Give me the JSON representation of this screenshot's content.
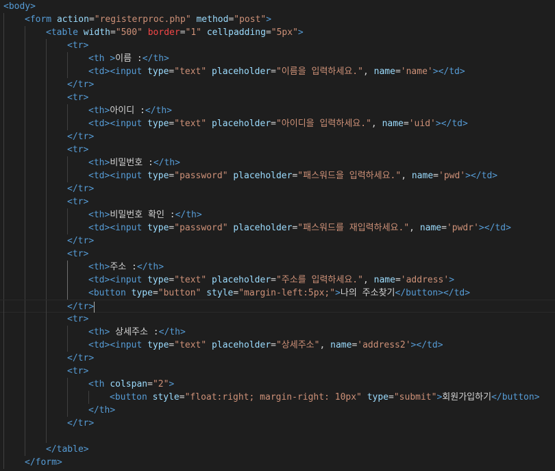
{
  "editor": {
    "language": "html",
    "colors": {
      "background": "#1e1e1e",
      "tag": "#569cd6",
      "attribute": "#9cdcfe",
      "string": "#ce9178",
      "text": "#d4d4d4",
      "deprecated_attribute": "#f44747"
    },
    "lines": [
      {
        "indent": 0,
        "code": "<body>"
      },
      {
        "indent": 1,
        "code": "<form action=\"registerproc.php\" method=\"post\">"
      },
      {
        "indent": 2,
        "code": "<table width=\"500\" border=\"1\" cellpadding=\"5px\">"
      },
      {
        "indent": 3,
        "code": "<tr>"
      },
      {
        "indent": 4,
        "code": "<th >이름 :</th>"
      },
      {
        "indent": 4,
        "code": "<td><input type=\"text\" placeholder=\"이름을 입력하세요.\", name='name'></td>"
      },
      {
        "indent": 3,
        "code": "</tr>"
      },
      {
        "indent": 3,
        "code": "<tr>"
      },
      {
        "indent": 4,
        "code": "<th>아이디 :</th>"
      },
      {
        "indent": 4,
        "code": "<td><input type=\"text\" placeholder=\"아이디을 입력하세요.\", name='uid'></td>"
      },
      {
        "indent": 3,
        "code": "</tr>"
      },
      {
        "indent": 3,
        "code": "<tr>"
      },
      {
        "indent": 4,
        "code": "<th>비밀번호 :</th>"
      },
      {
        "indent": 4,
        "code": "<td><input type=\"password\" placeholder=\"패스워드을 입력하세요.\", name='pwd'></td>"
      },
      {
        "indent": 3,
        "code": "</tr>"
      },
      {
        "indent": 3,
        "code": "<tr>"
      },
      {
        "indent": 4,
        "code": "<th>비밀번호 확인 :</th>"
      },
      {
        "indent": 4,
        "code": "<td><input type=\"password\" placeholder=\"패스워드를 재입력하세요.\", name='pwdr'></td>"
      },
      {
        "indent": 3,
        "code": "</tr>"
      },
      {
        "indent": 3,
        "code": "<tr>"
      },
      {
        "indent": 4,
        "code": "<th>주소 :</th>"
      },
      {
        "indent": 4,
        "code": "<td><input type=\"text\" placeholder=\"주소를 입력하세요.\", name='address'>"
      },
      {
        "indent": 4,
        "code": "<button type=\"button\" style=\"margin-left:5px;\">나의 주소찾기</button></td>"
      },
      {
        "indent": 3,
        "code": "</tr>",
        "cursor": true
      },
      {
        "indent": 3,
        "code": "<tr>"
      },
      {
        "indent": 4,
        "code": "<th> 상세주소 :</th>"
      },
      {
        "indent": 4,
        "code": "<td><input type=\"text\" placeholder=\"상세주소\", name='address2'></td>"
      },
      {
        "indent": 3,
        "code": "</tr>"
      },
      {
        "indent": 3,
        "code": "<tr>"
      },
      {
        "indent": 4,
        "code": "<th colspan=\"2\">"
      },
      {
        "indent": 5,
        "code": "<button style=\"float:right; margin-right: 10px\" type=\"submit\">회원가입하기</button>"
      },
      {
        "indent": 4,
        "code": "</th>"
      },
      {
        "indent": 3,
        "code": "</tr>"
      },
      {
        "indent": 3,
        "code": ""
      },
      {
        "indent": 2,
        "code": "</table>"
      },
      {
        "indent": 1,
        "code": "</form>"
      }
    ]
  }
}
